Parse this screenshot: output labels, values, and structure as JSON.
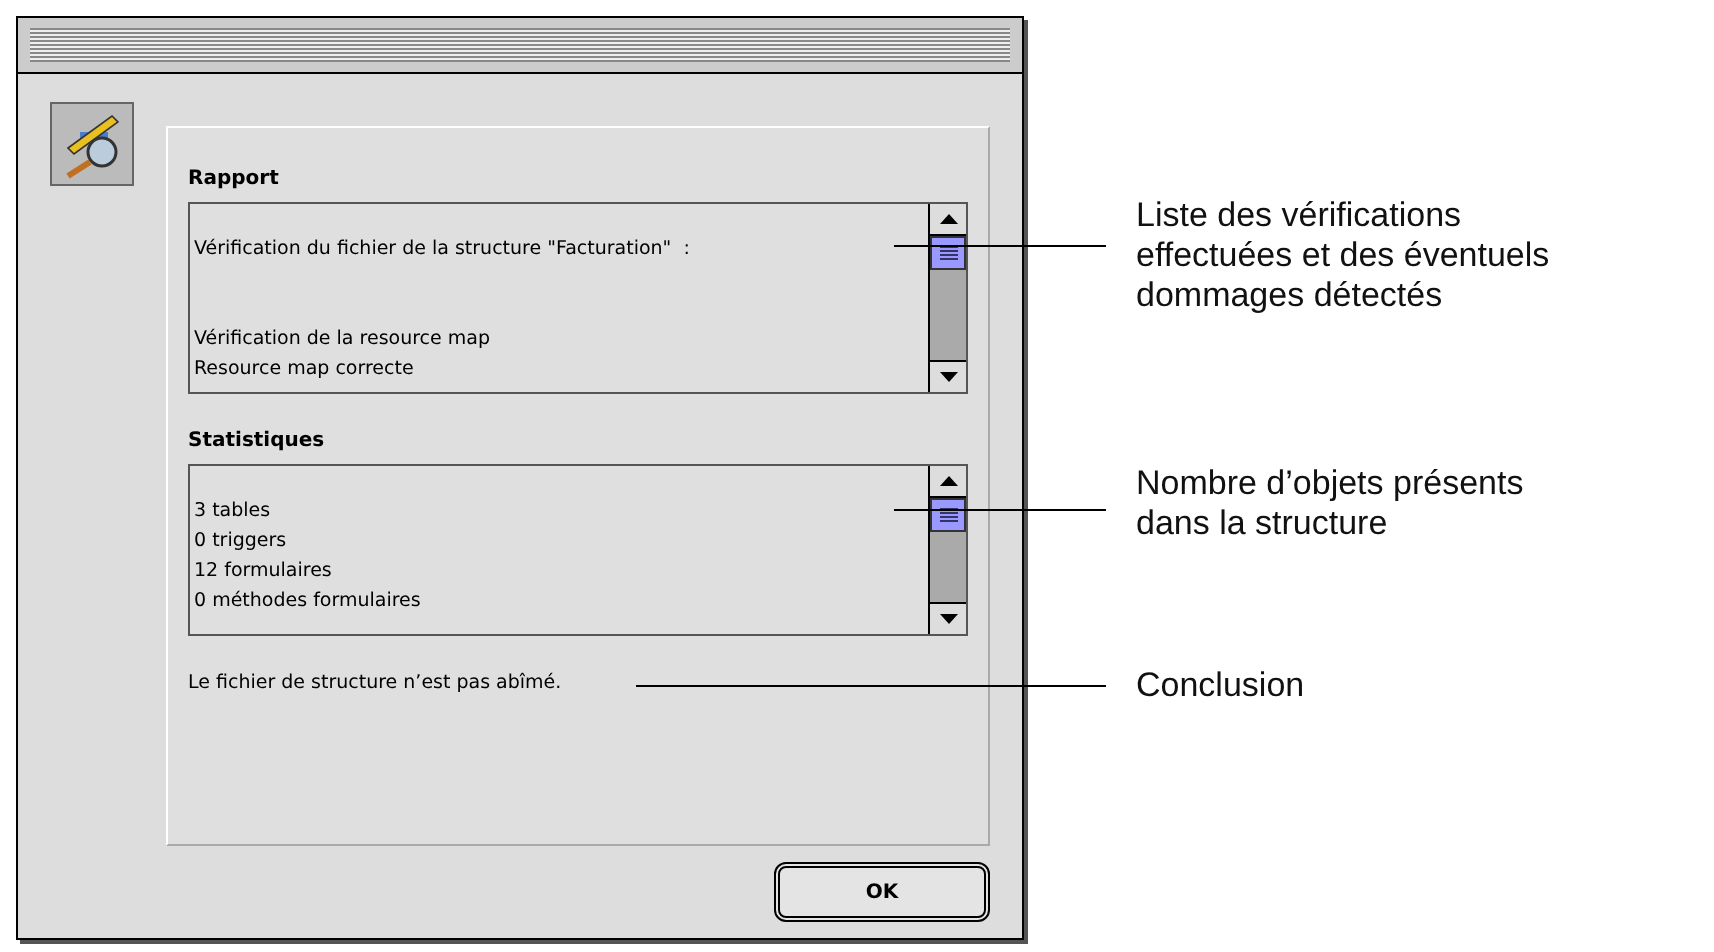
{
  "dialog": {
    "sections": [
      {
        "heading": "Rapport",
        "paragraphs": [
          [
            "Vérification du fichier de la structure \"Facturation\"  :"
          ],
          [
            "Vérification de la resource map",
            "Resource map correcte"
          ]
        ]
      },
      {
        "heading": "Statistiques",
        "paragraphs": [
          [
            "3 tables",
            "0 triggers",
            "12 formulaires",
            "0 méthodes formulaires"
          ]
        ]
      }
    ],
    "conclusion": "Le fichier de structure n’est pas abîmé.",
    "buttons": [
      "OK"
    ]
  },
  "callouts": [
    {
      "text": "Liste des vérifications effectuées et des éventuels dommages détectés"
    },
    {
      "text": "Nombre d’objets présents dans la structure"
    },
    {
      "text": "Conclusion"
    }
  ]
}
